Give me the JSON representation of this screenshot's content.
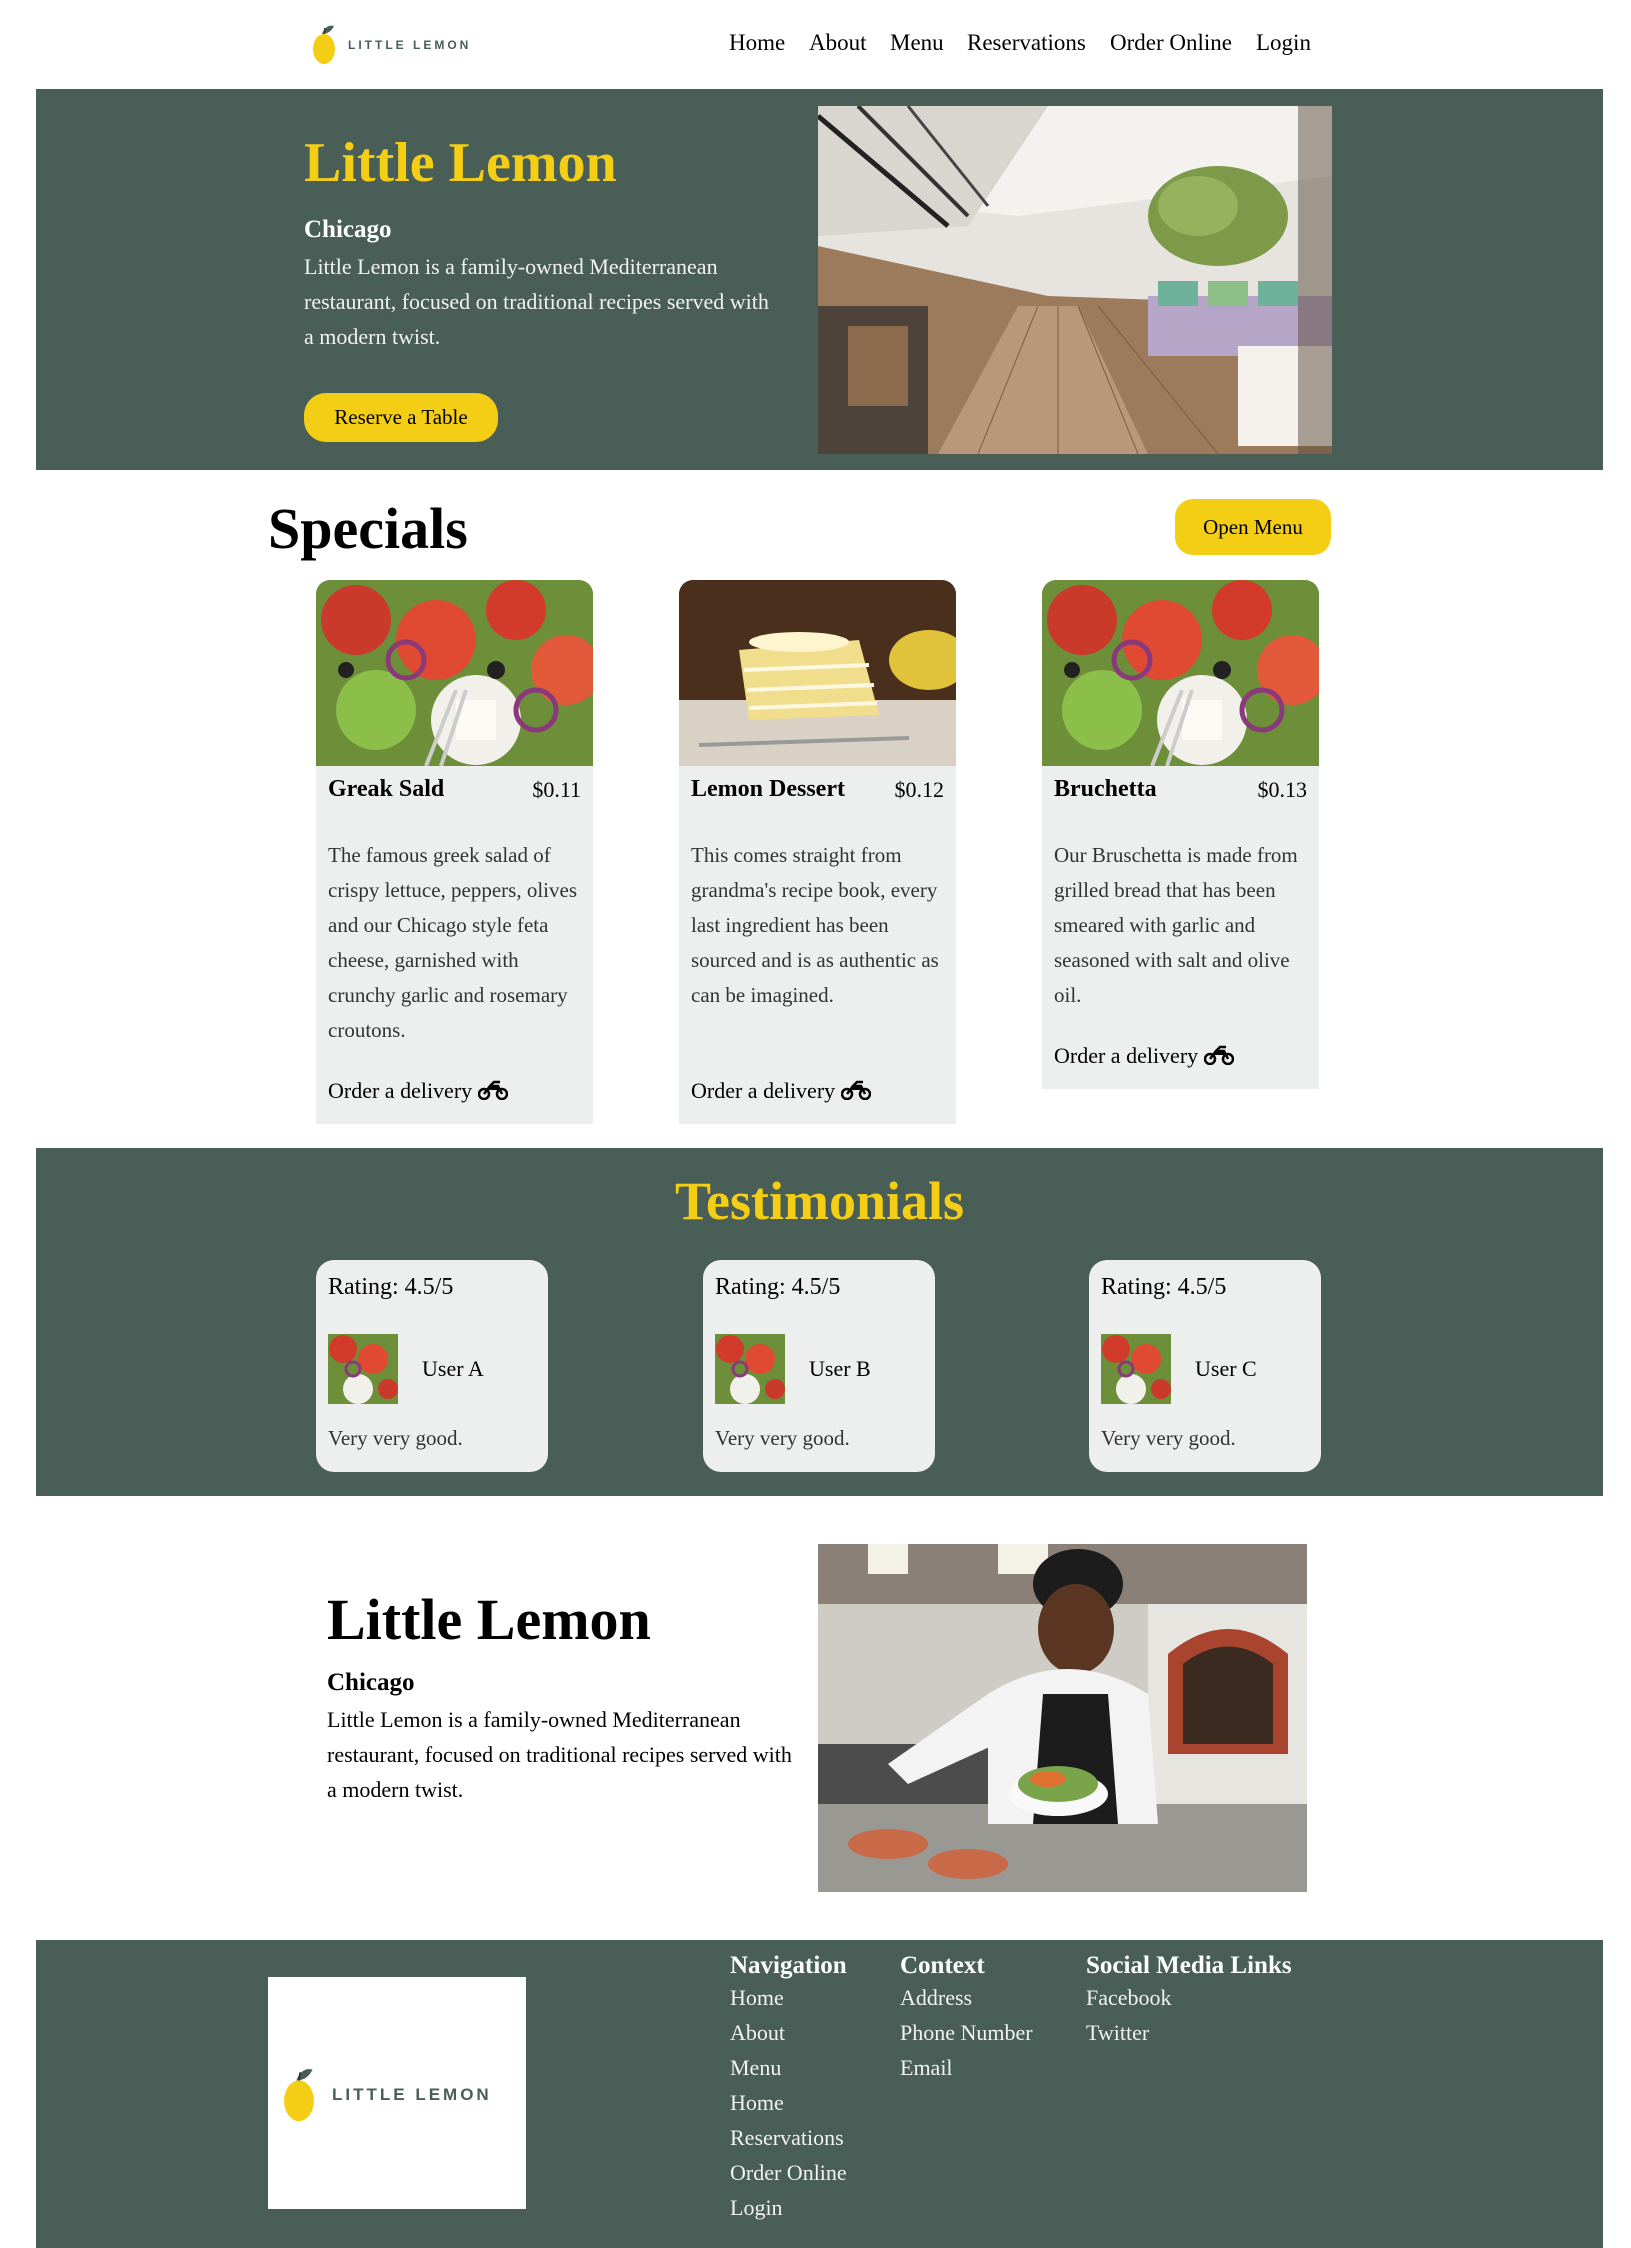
{
  "header": {
    "logo_text": "LITTLE LEMON",
    "nav": [
      "Home",
      "About",
      "Menu",
      "Reservations",
      "Order Online",
      "Login"
    ]
  },
  "hero": {
    "title": "Little Lemon",
    "subtitle": "Chicago",
    "description": "Little Lemon is a family-owned Mediterranean restaurant, focused on traditional recipes served with a modern twist.",
    "button": "Reserve a Table"
  },
  "specials": {
    "title": "Specials",
    "button": "Open Menu",
    "cards": [
      {
        "name": "Greak Sald",
        "price": "$0.11",
        "description": "The famous greek salad of crispy lettuce, peppers, olives and our Chicago style feta cheese, garnished with crunchy garlic and rosemary croutons.",
        "order": "Order a delivery"
      },
      {
        "name": "Lemon Dessert",
        "price": "$0.12",
        "description": "This comes straight from grandma's recipe book, every last ingredient has been sourced and is as authentic as can be imagined.",
        "order": "Order a delivery"
      },
      {
        "name": "Bruchetta",
        "price": "$0.13",
        "description": "Our Bruschetta is made from grilled bread that has been smeared with garlic and seasoned with salt and olive oil.",
        "order": "Order a delivery"
      }
    ]
  },
  "testimonials": {
    "title": "Testimonials",
    "items": [
      {
        "rating": "Rating: 4.5/5",
        "user": "User A",
        "review": "Very very good."
      },
      {
        "rating": "Rating: 4.5/5",
        "user": "User B",
        "review": "Very very good."
      },
      {
        "rating": "Rating: 4.5/5",
        "user": "User C",
        "review": "Very very good."
      }
    ]
  },
  "about": {
    "title": "Little Lemon",
    "subtitle": "Chicago",
    "description": "Little Lemon is a family-owned Mediterranean restaurant, focused on traditional recipes served with a modern twist."
  },
  "footer": {
    "logo_text": "LITTLE LEMON",
    "navigation": {
      "title": "Navigation",
      "links": [
        "Home",
        "About",
        "Menu",
        "Home",
        "Reservations",
        "Order Online",
        "Login"
      ]
    },
    "contact": {
      "title": "Context",
      "links": [
        "Address",
        "Phone Number",
        "Email"
      ]
    },
    "social": {
      "title": "Social Media Links",
      "links": [
        "Facebook",
        "Twitter"
      ]
    }
  },
  "colors": {
    "primary_green": "#495e57",
    "primary_yellow": "#f4ce14",
    "card_bg": "#edefee"
  },
  "icons": [
    "lemon-logo-icon",
    "motorbike-icon"
  ]
}
